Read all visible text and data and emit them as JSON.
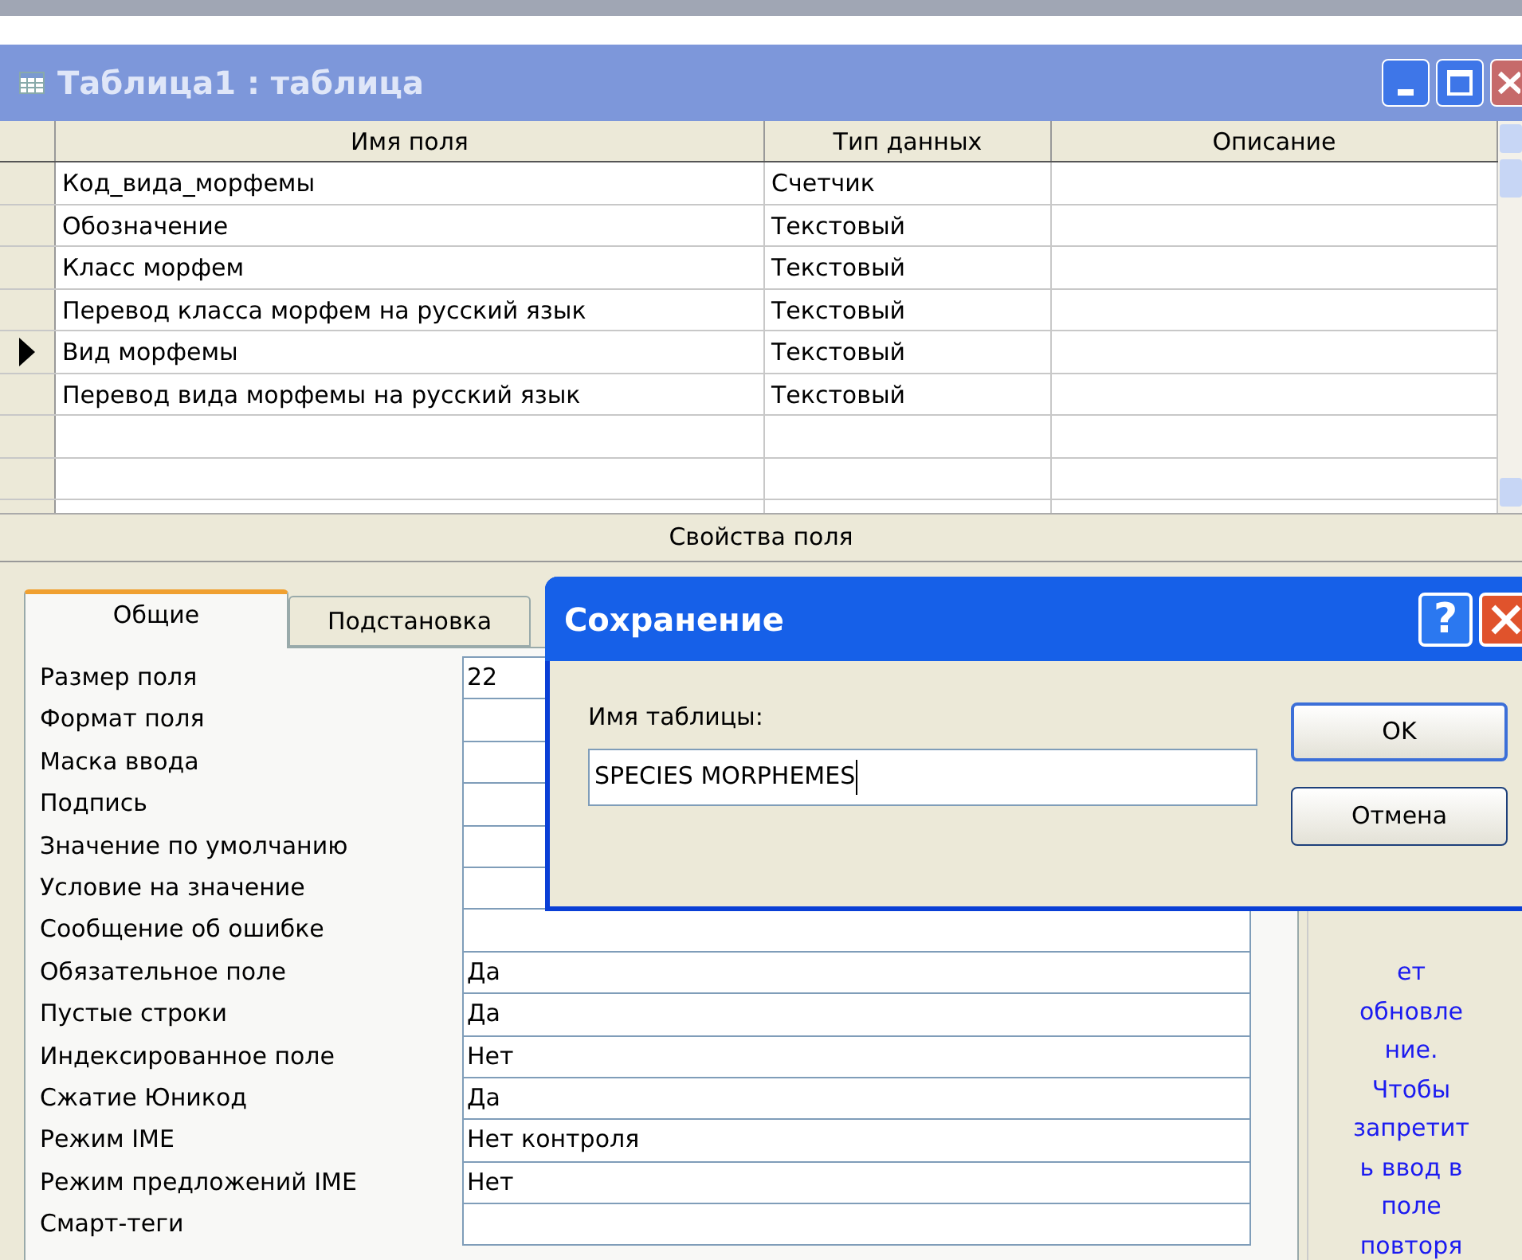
{
  "window": {
    "title": "Таблица1 : таблица"
  },
  "grid": {
    "columns": [
      "Имя поля",
      "Тип данных",
      "Описание"
    ],
    "rows": [
      {
        "name": "Код_вида_морфемы",
        "type": "Счетчик",
        "selected": false
      },
      {
        "name": "Обозначение",
        "type": "Текстовый",
        "selected": false
      },
      {
        "name": "Класс морфем",
        "type": "Текстовый",
        "selected": false
      },
      {
        "name": "Перевод класса морфем на русский язык",
        "type": "Текстовый",
        "selected": false
      },
      {
        "name": "Вид морфемы",
        "type": "Текстовый",
        "selected": true
      },
      {
        "name": "Перевод вида морфемы на русский язык",
        "type": "Текстовый",
        "selected": false
      }
    ]
  },
  "properties_title": "Свойства поля",
  "tabs": [
    {
      "label": "Общие",
      "selected": true
    },
    {
      "label": "Подстановка",
      "selected": false
    }
  ],
  "properties": [
    {
      "label": "Размер поля",
      "value": "22"
    },
    {
      "label": "Формат поля"
    },
    {
      "label": "Маска ввода"
    },
    {
      "label": "Подпись"
    },
    {
      "label": "Значение по умолчанию"
    },
    {
      "label": "Условие на значение"
    },
    {
      "label": "Сообщение об ошибке"
    },
    {
      "label": "Обязательное поле",
      "value": "Да"
    },
    {
      "label": "Пустые строки",
      "value": "Да"
    },
    {
      "label": "Индексированное поле",
      "value": "Нет"
    },
    {
      "label": "Сжатие Юникод",
      "value": "Да"
    },
    {
      "label": "Режим IME",
      "value": "Нет контроля"
    },
    {
      "label": "Режим предложений IME",
      "value": "Нет"
    },
    {
      "label": "Смарт-теги"
    }
  ],
  "help_lines": [
    "ет",
    "обновле",
    "ние.",
    "Чтобы",
    "запретит",
    "ь ввод в",
    "поле",
    "повторя"
  ],
  "dialog": {
    "title": "Сохранение",
    "help_button": "?",
    "label": "Имя таблицы:",
    "value": "SPECIES MORPHEMES",
    "buttons": [
      {
        "label": "OK",
        "default": true
      },
      {
        "label": "Отмена",
        "default": false
      }
    ]
  }
}
